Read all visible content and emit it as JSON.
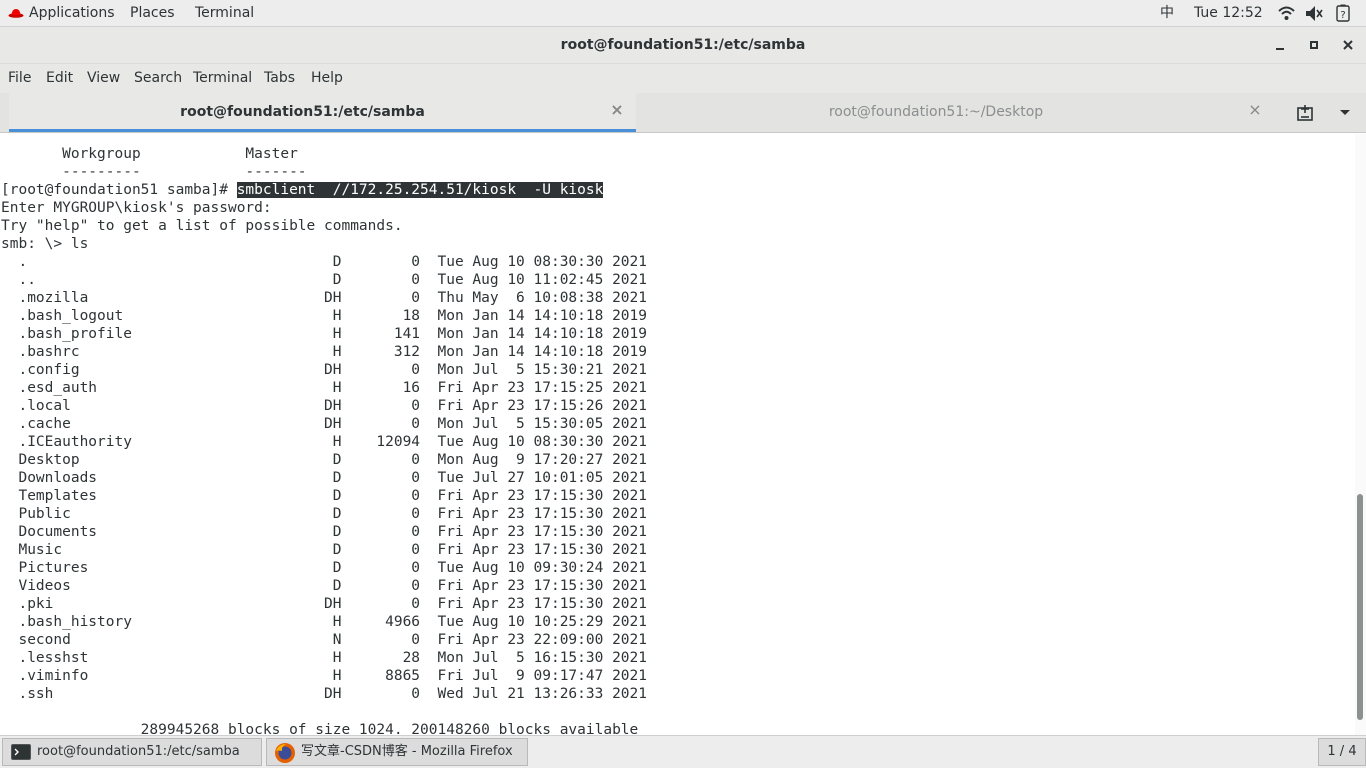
{
  "top_panel": {
    "applications": "Applications",
    "places": "Places",
    "terminal": "Terminal",
    "input_method": "中",
    "clock": "Tue 12:52"
  },
  "window": {
    "title": "root@foundation51:/etc/samba"
  },
  "menu": [
    "File",
    "Edit",
    "View",
    "Search",
    "Terminal",
    "Tabs",
    "Help"
  ],
  "tabs": [
    {
      "label": "root@foundation51:/etc/samba",
      "active": true
    },
    {
      "label": "root@foundation51:~/Desktop",
      "active": false
    }
  ],
  "terminal": {
    "lines": [
      {
        "text": "       Workgroup            Master"
      },
      {
        "text": "       ---------            -------"
      },
      {
        "prompt": "[root@foundation51 samba]# ",
        "command": "smbclient  //172.25.254.51/kiosk  -U kiosk"
      },
      {
        "text": "Enter MYGROUP\\kiosk's password:"
      },
      {
        "text": "Try \"help\" to get a list of possible commands."
      },
      {
        "text": "smb: \\> ls"
      },
      {
        "text": "  .                                   D        0  Tue Aug 10 08:30:30 2021"
      },
      {
        "text": "  ..                                  D        0  Tue Aug 10 11:02:45 2021"
      },
      {
        "text": "  .mozilla                           DH        0  Thu May  6 10:08:38 2021"
      },
      {
        "text": "  .bash_logout                        H       18  Mon Jan 14 14:10:18 2019"
      },
      {
        "text": "  .bash_profile                       H      141  Mon Jan 14 14:10:18 2019"
      },
      {
        "text": "  .bashrc                             H      312  Mon Jan 14 14:10:18 2019"
      },
      {
        "text": "  .config                            DH        0  Mon Jul  5 15:30:21 2021"
      },
      {
        "text": "  .esd_auth                           H       16  Fri Apr 23 17:15:25 2021"
      },
      {
        "text": "  .local                             DH        0  Fri Apr 23 17:15:26 2021"
      },
      {
        "text": "  .cache                             DH        0  Mon Jul  5 15:30:05 2021"
      },
      {
        "text": "  .ICEauthority                       H    12094  Tue Aug 10 08:30:30 2021"
      },
      {
        "text": "  Desktop                             D        0  Mon Aug  9 17:20:27 2021"
      },
      {
        "text": "  Downloads                           D        0  Tue Jul 27 10:01:05 2021"
      },
      {
        "text": "  Templates                           D        0  Fri Apr 23 17:15:30 2021"
      },
      {
        "text": "  Public                              D        0  Fri Apr 23 17:15:30 2021"
      },
      {
        "text": "  Documents                           D        0  Fri Apr 23 17:15:30 2021"
      },
      {
        "text": "  Music                               D        0  Fri Apr 23 17:15:30 2021"
      },
      {
        "text": "  Pictures                            D        0  Tue Aug 10 09:30:24 2021"
      },
      {
        "text": "  Videos                              D        0  Fri Apr 23 17:15:30 2021"
      },
      {
        "text": "  .pki                               DH        0  Fri Apr 23 17:15:30 2021"
      },
      {
        "text": "  .bash_history                       H     4966  Tue Aug 10 10:25:29 2021"
      },
      {
        "text": "  second                              N        0  Fri Apr 23 22:09:00 2021"
      },
      {
        "text": "  .lesshst                            H       28  Mon Jul  5 16:15:30 2021"
      },
      {
        "text": "  .viminfo                            H     8865  Fri Jul  9 09:17:47 2021"
      },
      {
        "text": "  .ssh                               DH        0  Wed Jul 21 13:26:33 2021"
      },
      {
        "text": ""
      },
      {
        "text": "                289945268 blocks of size 1024. 200148260 blocks available"
      }
    ]
  },
  "taskbar": {
    "tasks": [
      {
        "label": "root@foundation51:/etc/samba",
        "icon": "terminal-icon"
      },
      {
        "label": "写文章-CSDN博客 - Mozilla Firefox",
        "icon": "firefox-icon"
      }
    ],
    "workspace": "1 / 4"
  },
  "colors": {
    "accent": "#4a90d9",
    "panel": "#ededed",
    "terminal_fg": "#2e3436",
    "terminal_bg": "#ffffff"
  }
}
